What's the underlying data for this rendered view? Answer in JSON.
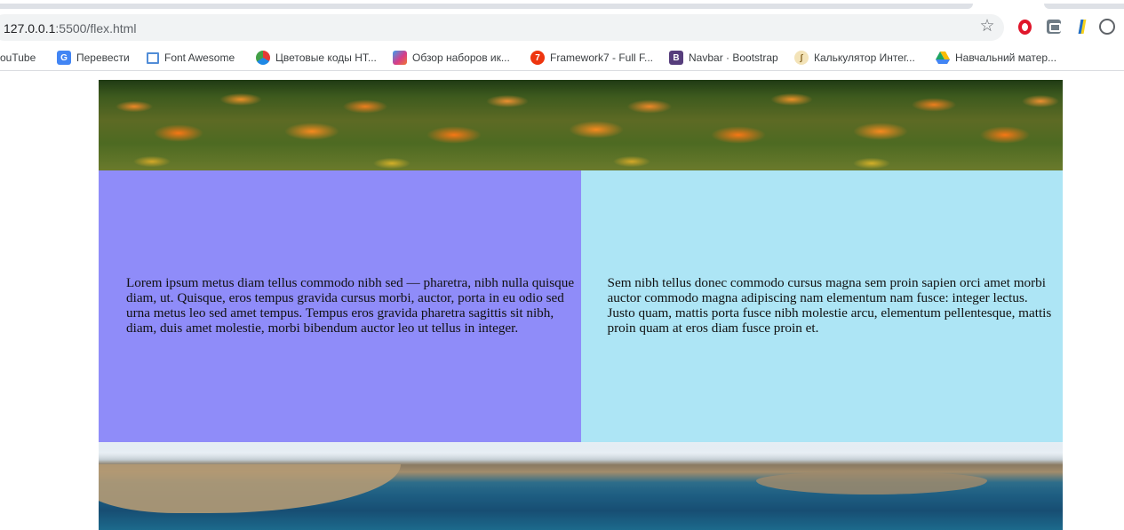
{
  "browser": {
    "url_host": "127.0.0.1",
    "url_path": ":5500/flex.html",
    "bookmarks": [
      {
        "label": "ouTube",
        "icon": "youtube-icon"
      },
      {
        "label": "Перевести",
        "icon": "google-translate-icon",
        "color": "#4285f4"
      },
      {
        "label": "Font Awesome",
        "icon": "font-awesome-flag-icon",
        "color": "#528dd7"
      },
      {
        "label": "Цветовые коды HT...",
        "icon": "color-wheel-icon",
        "color": "#e53935"
      },
      {
        "label": "Обзор наборов ик...",
        "icon": "icon-set-review-icon",
        "color": "#d63c8a"
      },
      {
        "label": "Framework7 - Full F...",
        "icon": "framework7-icon",
        "color": "#ee350f"
      },
      {
        "label": "Navbar · Bootstrap",
        "icon": "bootstrap-icon",
        "color": "#563d7c"
      },
      {
        "label": "Калькулятор Интег...",
        "icon": "integral-calculator-icon",
        "color": "#c8a050"
      },
      {
        "label": "Навчальний матер...",
        "icon": "google-drive-icon",
        "color": "#1fa463"
      }
    ]
  },
  "content": {
    "left_text": "Lorem ipsum metus diam tellus commodo nibh sed — pharetra, nibh nulla quisque diam, ut. Quisque, eros tempus gravida cursus morbi, auctor, porta in eu odio sed urna metus leo sed amet tempus. Tempus eros gravida pharetra sagittis sit nibh, diam, duis amet molestie, morbi bibendum auctor leo ut tellus in integer.",
    "right_text": "Sem nibh tellus donec commodo cursus magna sem proin sapien orci amet morbi auctor commodo magna adipiscing nam elementum nam fusce: integer lectus. Justo quam, mattis porta fusce nibh molestie arcu, elementum pellentesque, mattis proin quam at eros diam fusce proin et.",
    "colors": {
      "left_bg": "#8f8cf9",
      "right_bg": "#ade5f5"
    }
  }
}
